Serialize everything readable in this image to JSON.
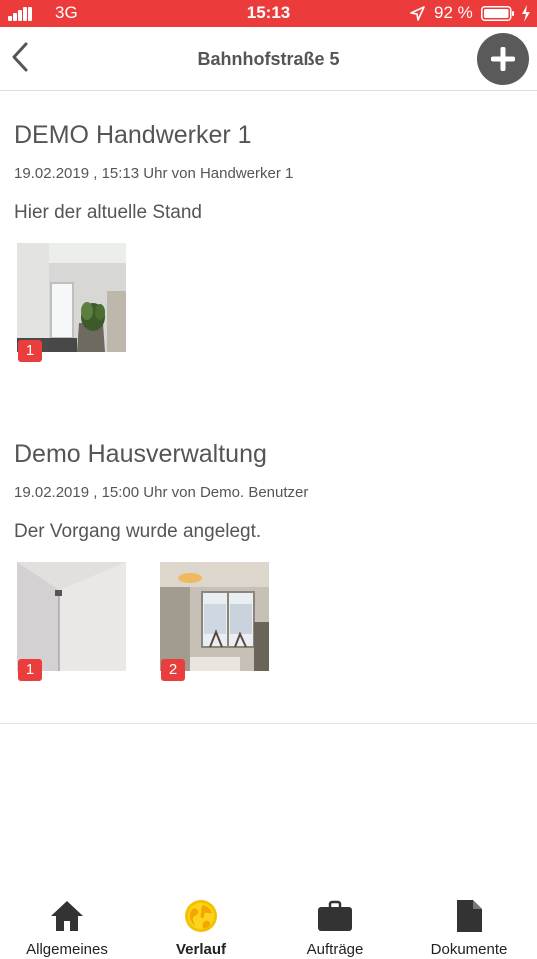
{
  "status_bar": {
    "carrier": "3G",
    "time": "15:13",
    "battery_percent": "92 %",
    "background_color": "#ec3b3b"
  },
  "nav": {
    "title": "Bahnhofstraße 5",
    "back_icon": "chevron-left-icon",
    "add_icon": "plus-icon"
  },
  "entries": [
    {
      "title": "DEMO Handwerker 1",
      "meta": "19.02.2019 , 15:13 Uhr von Handwerker 1",
      "text": "Hier der altuelle Stand",
      "photos": [
        {
          "badge": "1",
          "scene": "room-corner-with-plant"
        }
      ]
    },
    {
      "title": "Demo Hausverwaltung",
      "meta": "19.02.2019 , 15:00 Uhr von Demo. Benutzer",
      "text": "Der Vorgang wurde angelegt.",
      "photos": [
        {
          "badge": "1",
          "scene": "wall-corner"
        },
        {
          "badge": "2",
          "scene": "living-room-window"
        }
      ]
    }
  ],
  "tabs": [
    {
      "label": "Allgemeines",
      "icon": "home-icon",
      "active": false
    },
    {
      "label": "Verlauf",
      "icon": "globe-icon",
      "active": true
    },
    {
      "label": "Aufträge",
      "icon": "briefcase-icon",
      "active": false
    },
    {
      "label": "Dokumente",
      "icon": "document-icon",
      "active": false
    }
  ],
  "colors": {
    "accent": "#ec3b3b",
    "badge": "#ea3e3e",
    "active_tab_icon": "#f2c200",
    "inactive_tab_icon": "#333333"
  }
}
